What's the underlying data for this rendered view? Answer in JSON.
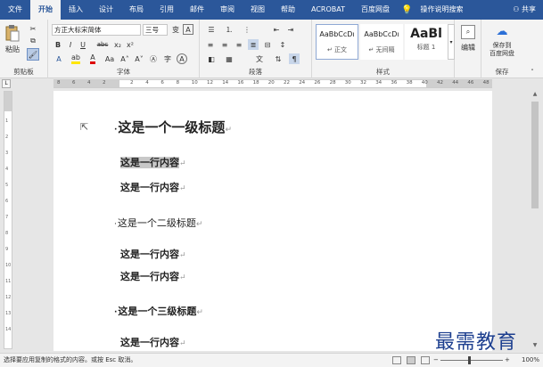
{
  "tabs": [
    "文件",
    "开始",
    "插入",
    "设计",
    "布局",
    "引用",
    "邮件",
    "审阅",
    "视图",
    "帮助",
    "ACROBAT",
    "百度网盘",
    "操作说明搜索"
  ],
  "share_label": "共享",
  "ribbon": {
    "clipboard": {
      "paste": "粘贴",
      "group": "剪贴板"
    },
    "font": {
      "name": "方正大标宋简体",
      "size": "三号",
      "group": "字体",
      "bold": "B",
      "italic": "I",
      "underline": "U",
      "strike": "abc",
      "sub": "x₂",
      "sup": "x²"
    },
    "paragraph": {
      "group": "段落"
    },
    "styles": {
      "items": [
        {
          "sample": "AaBbCcDı",
          "name": "↵ 正文"
        },
        {
          "sample": "AaBbCcDı",
          "name": "↵ 无间隔"
        },
        {
          "sample": "AaBl",
          "name": "标题 1"
        }
      ],
      "group": "样式"
    },
    "editing": {
      "label": "编辑"
    },
    "save": {
      "label1": "保存到",
      "label2": "百度网盘",
      "group": "保存"
    }
  },
  "ruler_numbers": [
    "8",
    "6",
    "4",
    "2",
    "2",
    "4",
    "6",
    "8",
    "10",
    "12",
    "14",
    "16",
    "18",
    "20",
    "22",
    "24",
    "26",
    "28",
    "30",
    "32",
    "34",
    "36",
    "38",
    "40",
    "42",
    "44",
    "46",
    "48"
  ],
  "document": {
    "lines": [
      {
        "type": "h1",
        "text": "这是一个一级标题"
      },
      {
        "type": "body",
        "text": "这是一行内容",
        "selected": true
      },
      {
        "type": "body",
        "text": "这是一行内容"
      },
      {
        "type": "h2",
        "text": "这是一个二级标题"
      },
      {
        "type": "body",
        "text": "这是一行内容"
      },
      {
        "type": "body",
        "text": "这是一行内容"
      },
      {
        "type": "h3",
        "text": "这是一个三级标题"
      },
      {
        "type": "body",
        "text": "这是一行内容"
      }
    ],
    "para_mark": "↵",
    "bullet": "·"
  },
  "status": {
    "message": "选择要应用复制的格式的内容。或按 Esc 取消。",
    "zoom": "100%"
  },
  "watermark": "最需教育"
}
